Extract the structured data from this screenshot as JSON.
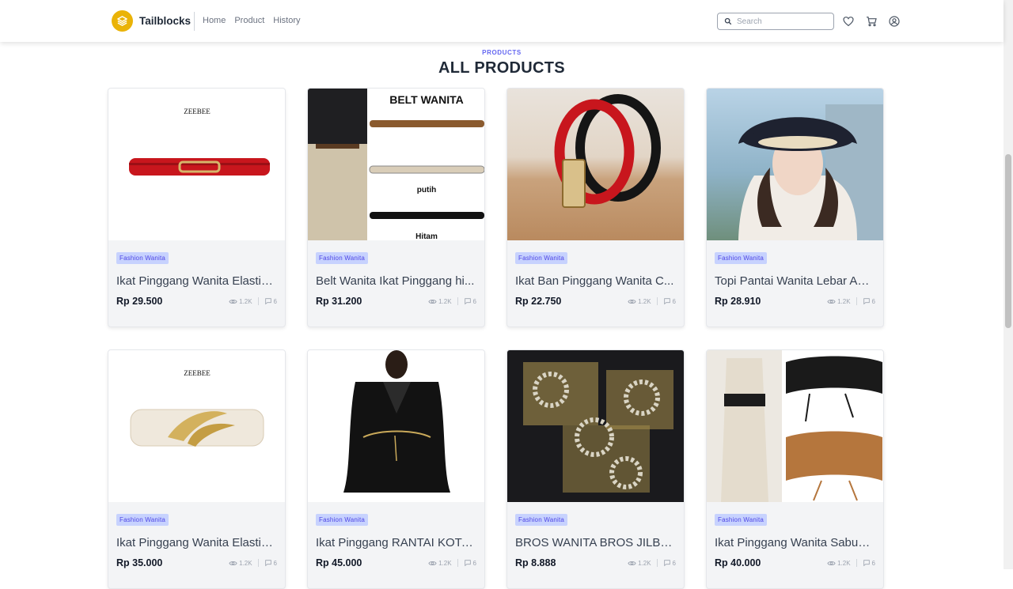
{
  "brand": {
    "name": "Tailblocks"
  },
  "nav": [
    "Home",
    "Product",
    "History"
  ],
  "search": {
    "placeholder": "Search"
  },
  "section": {
    "eyebrow": "PRODUCTS",
    "title": "ALL PRODUCTS"
  },
  "colors": {
    "accent": "#6366f1",
    "brand": "#eab308",
    "badge_bg": "#c7d2fe"
  },
  "products": [
    {
      "category": "Fashion Wanita",
      "title": "Ikat Pinggang Wanita Elastis ...",
      "price": "Rp 29.500",
      "views": "1.2K",
      "comments": "6",
      "image": "red-elastic-belt",
      "image_text": "ZEEBEE"
    },
    {
      "category": "Fashion Wanita",
      "title": "Belt Wanita Ikat Pinggang hi...",
      "price": "Rp 31.200",
      "views": "1.2K",
      "comments": "6",
      "image": "belt-color-options",
      "image_text": "BELT WANITA",
      "image_labels": [
        "putih",
        "Hitam"
      ]
    },
    {
      "category": "Fashion Wanita",
      "title": "Ikat Ban Pinggang Wanita C...",
      "price": "Rp 22.750",
      "views": "1.2K",
      "comments": "6",
      "image": "red-leather-belt"
    },
    {
      "category": "Fashion Wanita",
      "title": "Topi Pantai Wanita Lebar Ant...",
      "price": "Rp 28.910",
      "views": "1.2K",
      "comments": "6",
      "image": "woman-beach-hat"
    },
    {
      "category": "Fashion Wanita",
      "title": "Ikat Pinggang Wanita Elastis ...",
      "price": "Rp 35.000",
      "views": "1.2K",
      "comments": "6",
      "image": "white-leaf-belt",
      "image_text": "ZEEBEE"
    },
    {
      "category": "Fashion Wanita",
      "title": "Ikat Pinggang RANTAI KOTA...",
      "price": "Rp 45.000",
      "views": "1.2K",
      "comments": "6",
      "image": "chain-belt-black-dress"
    },
    {
      "category": "Fashion Wanita",
      "title": "BROS WANITA BROS JILBAB ...",
      "price": "Rp 8.888",
      "views": "1.2K",
      "comments": "6",
      "image": "flower-brooches"
    },
    {
      "category": "Fashion Wanita",
      "title": "Ikat Pinggang Wanita Sabuk ...",
      "price": "Rp 40.000",
      "views": "1.2K",
      "comments": "6",
      "image": "lace-wrap-belts"
    }
  ]
}
